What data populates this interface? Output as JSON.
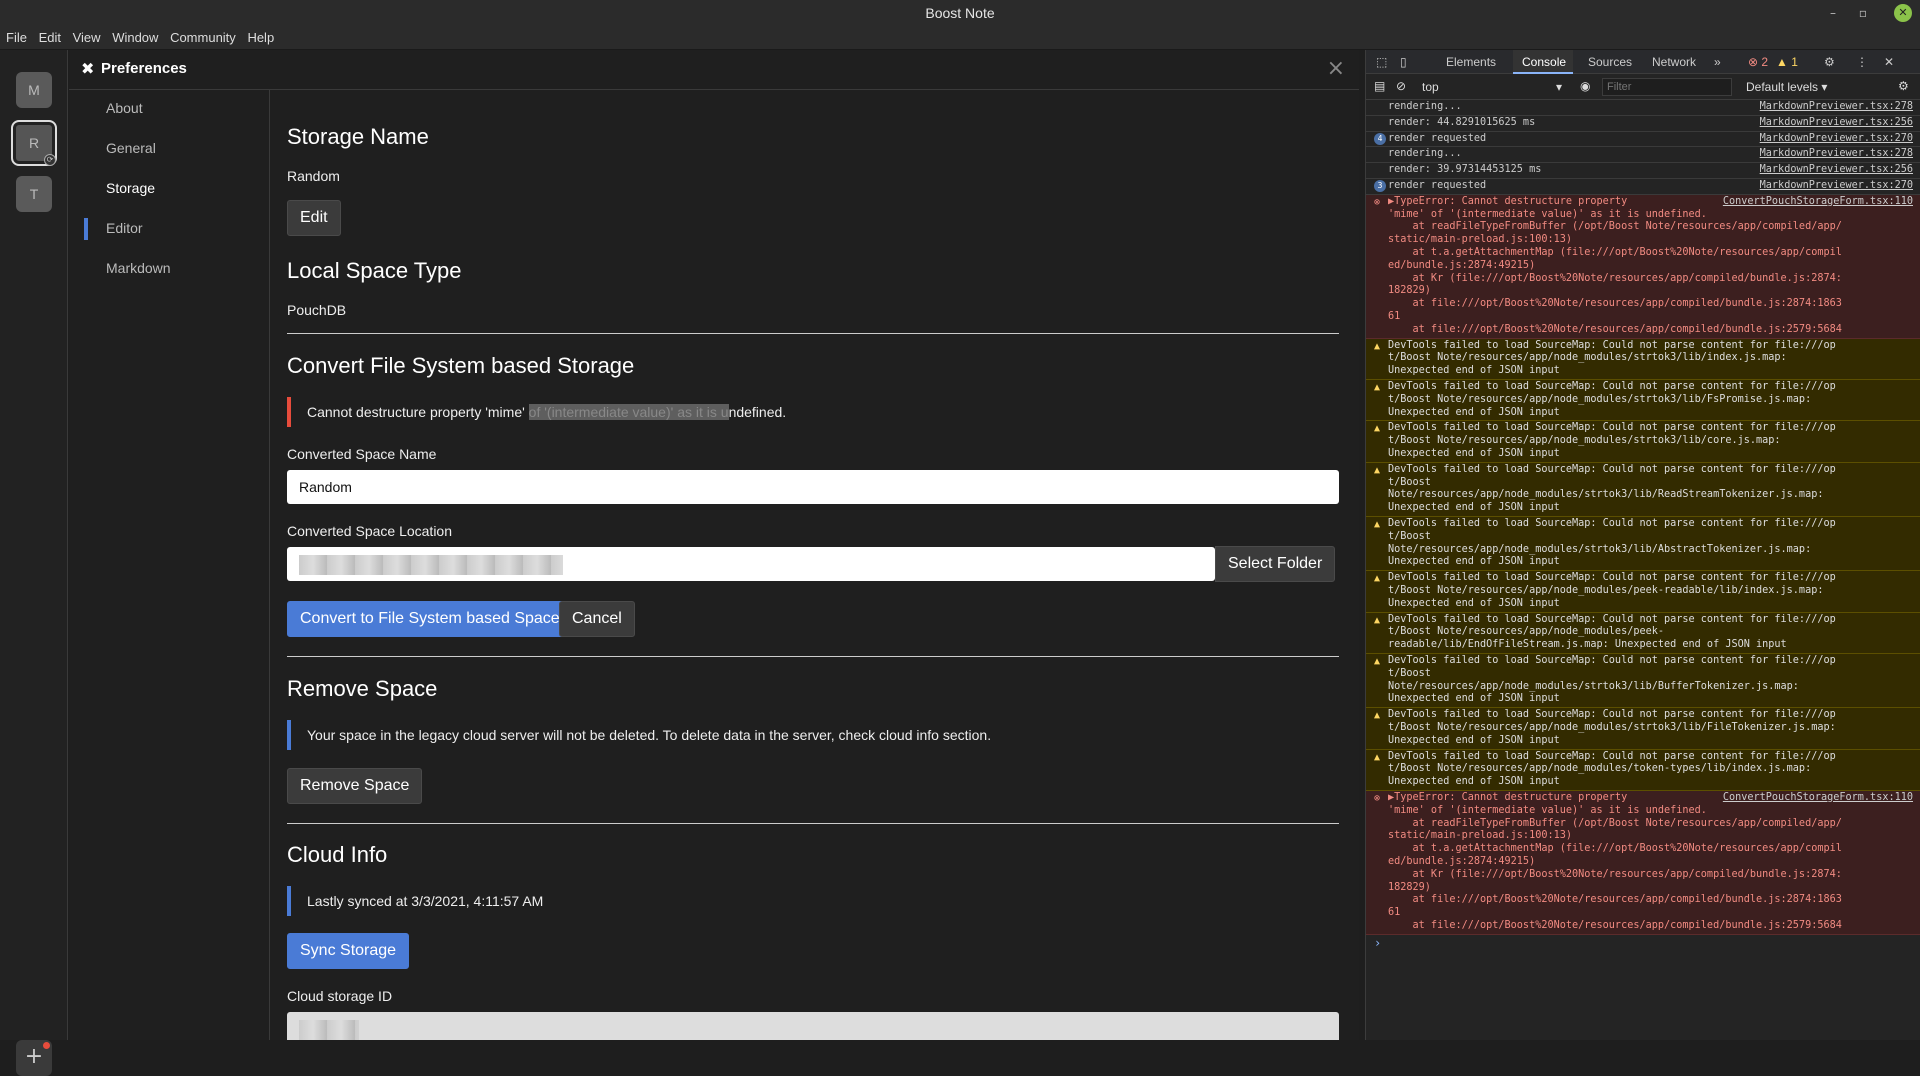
{
  "window": {
    "title": "Boost Note"
  },
  "menu": [
    "File",
    "Edit",
    "View",
    "Window",
    "Community",
    "Help"
  ],
  "rail": {
    "spaces": [
      "M",
      "R",
      "T"
    ],
    "add": "+"
  },
  "prefs": {
    "title": "Preferences",
    "nav": [
      "About",
      "General",
      "Storage",
      "Editor",
      "Markdown"
    ],
    "storage_name_h": "Storage Name",
    "storage_name": "Random",
    "edit": "Edit",
    "local_type_h": "Local Space Type",
    "local_type": "PouchDB",
    "convert_h": "Convert File System based Storage",
    "error_pre": "Cannot destructure property 'mime' ",
    "error_hl": "of '(intermediate value)' as it is u",
    "error_post": "ndefined.",
    "conv_name_label": "Converted Space Name",
    "conv_name_value": "Random",
    "conv_loc_label": "Converted Space Location",
    "select_folder": "Select Folder",
    "convert_btn": "Convert to File System based Space",
    "cancel_btn": "Cancel",
    "remove_h": "Remove Space",
    "remove_note": "Your space in the legacy cloud server will not be deleted. To delete data in the server, check cloud info section.",
    "remove_btn": "Remove Space",
    "cloud_h": "Cloud Info",
    "last_synced": "Lastly synced at 3/3/2021, 4:11:57 AM",
    "sync_btn": "Sync Storage",
    "cloud_id_label": "Cloud storage ID"
  },
  "devtools": {
    "tabs": [
      "Elements",
      "Console",
      "Sources",
      "Network"
    ],
    "more": "»",
    "errors": "2",
    "warnings": "1",
    "context": "top",
    "filter_placeholder": "Filter",
    "levels": "Default levels ▾",
    "logs": [
      {
        "text": "rendering...",
        "src": "MarkdownPreviewer.tsx:278"
      },
      {
        "text": "render: 44.8291015625 ms",
        "src": "MarkdownPreviewer.tsx:256"
      },
      {
        "text": "render requested",
        "src": "MarkdownPreviewer.tsx:270",
        "count": "4"
      },
      {
        "text": "rendering...",
        "src": "MarkdownPreviewer.tsx:278"
      },
      {
        "text": "render: 39.97314453125 ms",
        "src": "MarkdownPreviewer.tsx:256"
      },
      {
        "text": "render requested",
        "src": "MarkdownPreviewer.tsx:270",
        "count": "3"
      }
    ],
    "error1": {
      "src": "ConvertPouchStorageForm.tsx:110",
      "lines": [
        "▶TypeError: Cannot destructure property",
        "'mime' of '(intermediate value)' as it is undefined.",
        "    at readFileTypeFromBuffer (/opt/Boost Note/resources/app/compiled/app/",
        "static/main-preload.js:100:13)",
        "    at t.a.getAttachmentMap (file:///opt/Boost%20Note/resources/app/compil",
        "ed/bundle.js:2874:49215)",
        "    at Kr (file:///opt/Boost%20Note/resources/app/compiled/bundle.js:2874:",
        "182829)",
        "    at file:///opt/Boost%20Note/resources/app/compiled/bundle.js:2874:1863",
        "61",
        "    at file:///opt/Boost%20Note/resources/app/compiled/bundle.js:2579:5684"
      ]
    },
    "warns": [
      [
        "DevTools failed to load SourceMap: Could not parse content for file:///op",
        "t/Boost Note/resources/app/node_modules/strtok3/lib/index.js.map:",
        "Unexpected end of JSON input"
      ],
      [
        "DevTools failed to load SourceMap: Could not parse content for file:///op",
        "t/Boost Note/resources/app/node_modules/strtok3/lib/FsPromise.js.map:",
        "Unexpected end of JSON input"
      ],
      [
        "DevTools failed to load SourceMap: Could not parse content for file:///op",
        "t/Boost Note/resources/app/node_modules/strtok3/lib/core.js.map:",
        "Unexpected end of JSON input"
      ],
      [
        "DevTools failed to load SourceMap: Could not parse content for file:///op",
        "t/Boost",
        "Note/resources/app/node_modules/strtok3/lib/ReadStreamTokenizer.js.map:",
        "Unexpected end of JSON input"
      ],
      [
        "DevTools failed to load SourceMap: Could not parse content for file:///op",
        "t/Boost",
        "Note/resources/app/node_modules/strtok3/lib/AbstractTokenizer.js.map:",
        "Unexpected end of JSON input"
      ],
      [
        "DevTools failed to load SourceMap: Could not parse content for file:///op",
        "t/Boost Note/resources/app/node_modules/peek-readable/lib/index.js.map:",
        "Unexpected end of JSON input"
      ],
      [
        "DevTools failed to load SourceMap: Could not parse content for file:///op",
        "t/Boost Note/resources/app/node_modules/peek-",
        "readable/lib/EndOfFileStream.js.map: Unexpected end of JSON input"
      ],
      [
        "DevTools failed to load SourceMap: Could not parse content for file:///op",
        "t/Boost",
        "Note/resources/app/node_modules/strtok3/lib/BufferTokenizer.js.map:",
        "Unexpected end of JSON input"
      ],
      [
        "DevTools failed to load SourceMap: Could not parse content for file:///op",
        "t/Boost Note/resources/app/node_modules/strtok3/lib/FileTokenizer.js.map:",
        "Unexpected end of JSON input"
      ],
      [
        "DevTools failed to load SourceMap: Could not parse content for file:///op",
        "t/Boost Note/resources/app/node_modules/token-types/lib/index.js.map:",
        "Unexpected end of JSON input"
      ]
    ],
    "prompt": "›"
  }
}
